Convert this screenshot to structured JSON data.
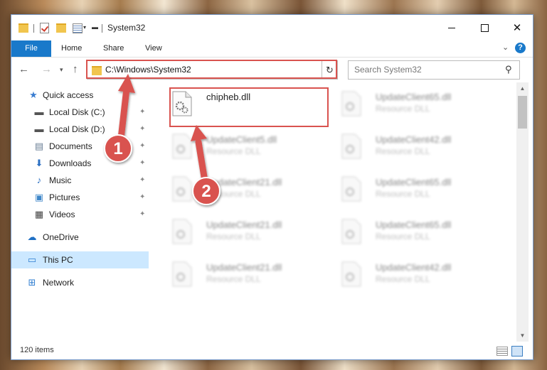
{
  "window": {
    "title": "System32"
  },
  "ribbon": {
    "tabs": [
      "File",
      "Home",
      "Share",
      "View"
    ],
    "help": "?"
  },
  "nav": {
    "address": "C:\\Windows\\System32",
    "search_placeholder": "Search System32"
  },
  "sidebar": {
    "items": [
      {
        "label": "Quick access"
      },
      {
        "label": "Local Disk (C:)"
      },
      {
        "label": "Local Disk (D:)"
      },
      {
        "label": "Documents"
      },
      {
        "label": "Downloads"
      },
      {
        "label": "Music"
      },
      {
        "label": "Pictures"
      },
      {
        "label": "Videos"
      },
      {
        "label": "OneDrive"
      },
      {
        "label": "This PC"
      },
      {
        "label": "Network"
      }
    ]
  },
  "files": [
    {
      "name": "chipheb.dll",
      "type": ""
    },
    {
      "name": "UpdateClient65.dll",
      "type": "Resource DLL"
    },
    {
      "name": "UpdateClient5.dll",
      "type": "Resource DLL"
    },
    {
      "name": "UpdateClient42.dll",
      "type": "Resource DLL"
    },
    {
      "name": "UpdateClient21.dll",
      "type": "Resource DLL"
    },
    {
      "name": "UpdateClient65.dll",
      "type": "Resource DLL"
    },
    {
      "name": "UpdateClient21.dll",
      "type": "Resource DLL"
    },
    {
      "name": "UpdateClient65.dll",
      "type": "Resource DLL"
    },
    {
      "name": "UpdateClient21.dll",
      "type": "Resource DLL"
    },
    {
      "name": "UpdateClient42.dll",
      "type": "Resource DLL"
    }
  ],
  "status": {
    "item_count": "120 items"
  },
  "annotations": [
    {
      "label": "1"
    },
    {
      "label": "2"
    }
  ],
  "colors": {
    "accent": "#1979ca",
    "highlight": "#d9534f",
    "selected": "#cce8ff"
  }
}
